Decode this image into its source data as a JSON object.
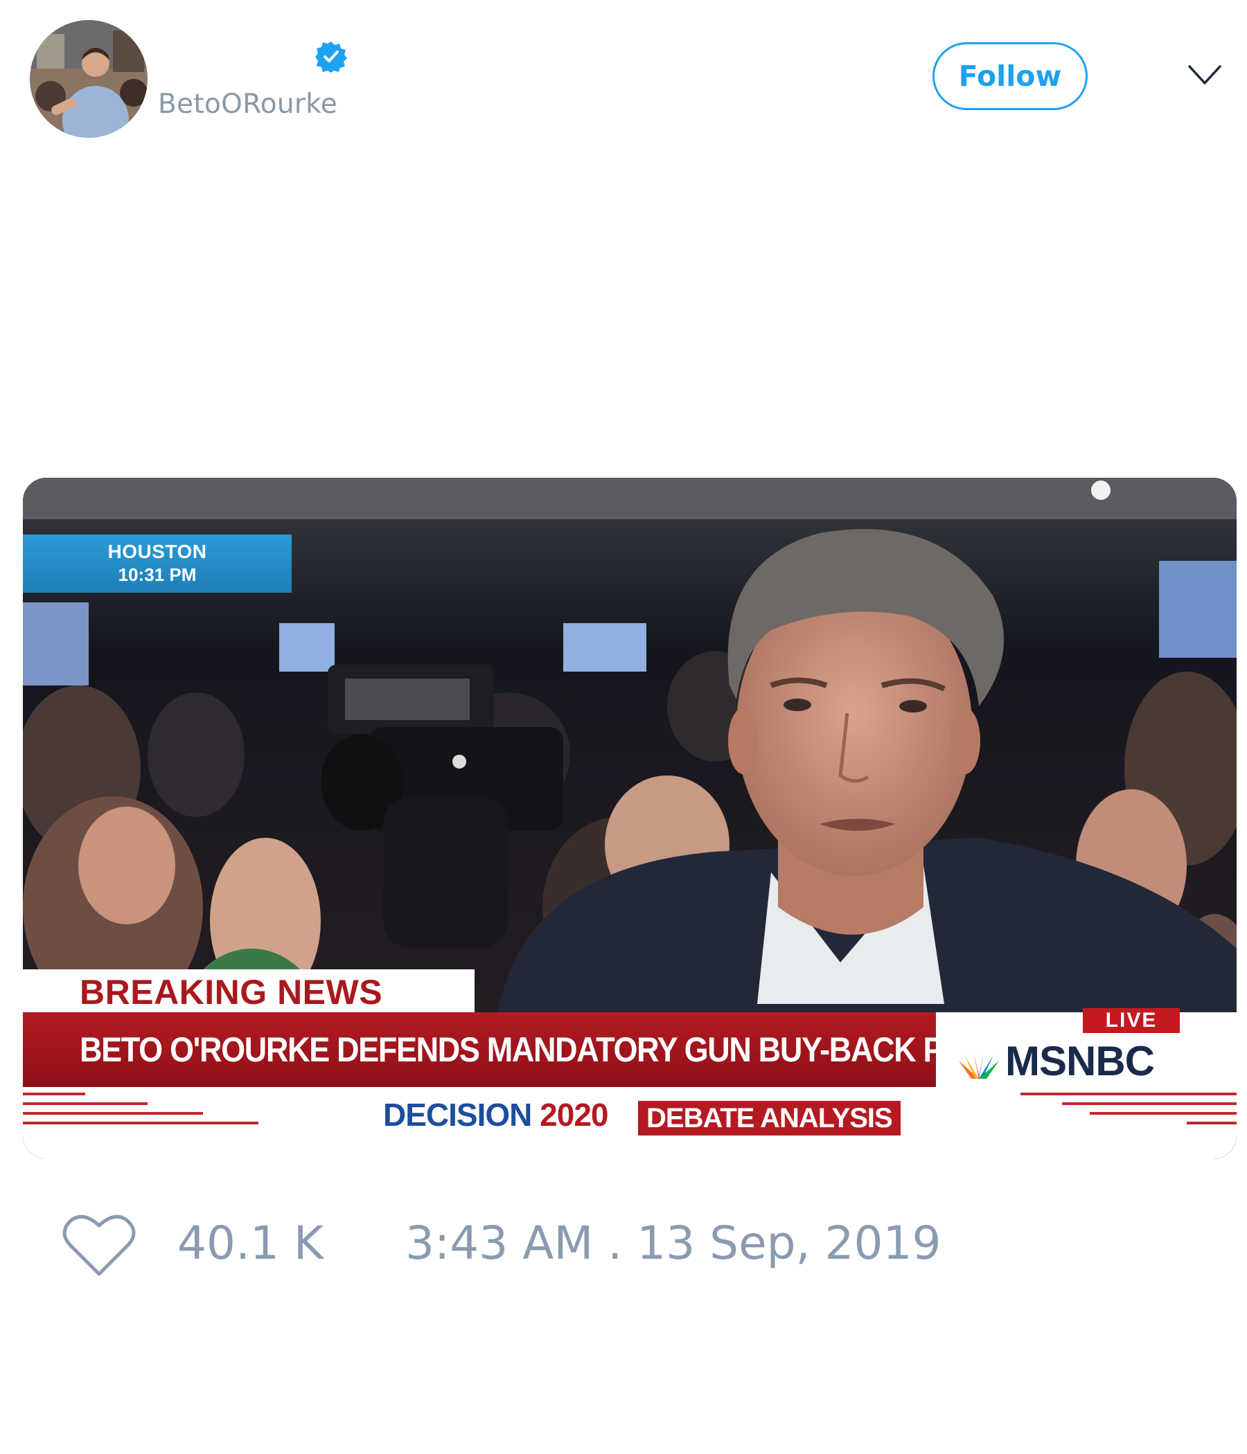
{
  "user": {
    "handle": "BetoORourke",
    "verified": true,
    "avatar_icon": "profile-photo"
  },
  "actions": {
    "follow_label": "Follow",
    "menu_icon": "chevron-down-icon"
  },
  "media": {
    "type": "video-still",
    "location": "HOUSTON",
    "time": "10:31 PM",
    "breaking_label": "BREAKING NEWS",
    "headline": "BETO O'ROURKE DEFENDS MANDATORY GUN BUY-BACK POLICY",
    "live_label": "LIVE",
    "network": "MSNBC",
    "decision_label": "DECISION",
    "decision_year": "2020",
    "segment_label": "DEBATE ANALYSIS"
  },
  "stats": {
    "likes": "40.1 K",
    "timestamp": "3:43 AM . 13 Sep, 2019"
  },
  "colors": {
    "accent": "#1da1f2",
    "muted": "#8899a6",
    "news_red": "#b31a22"
  }
}
